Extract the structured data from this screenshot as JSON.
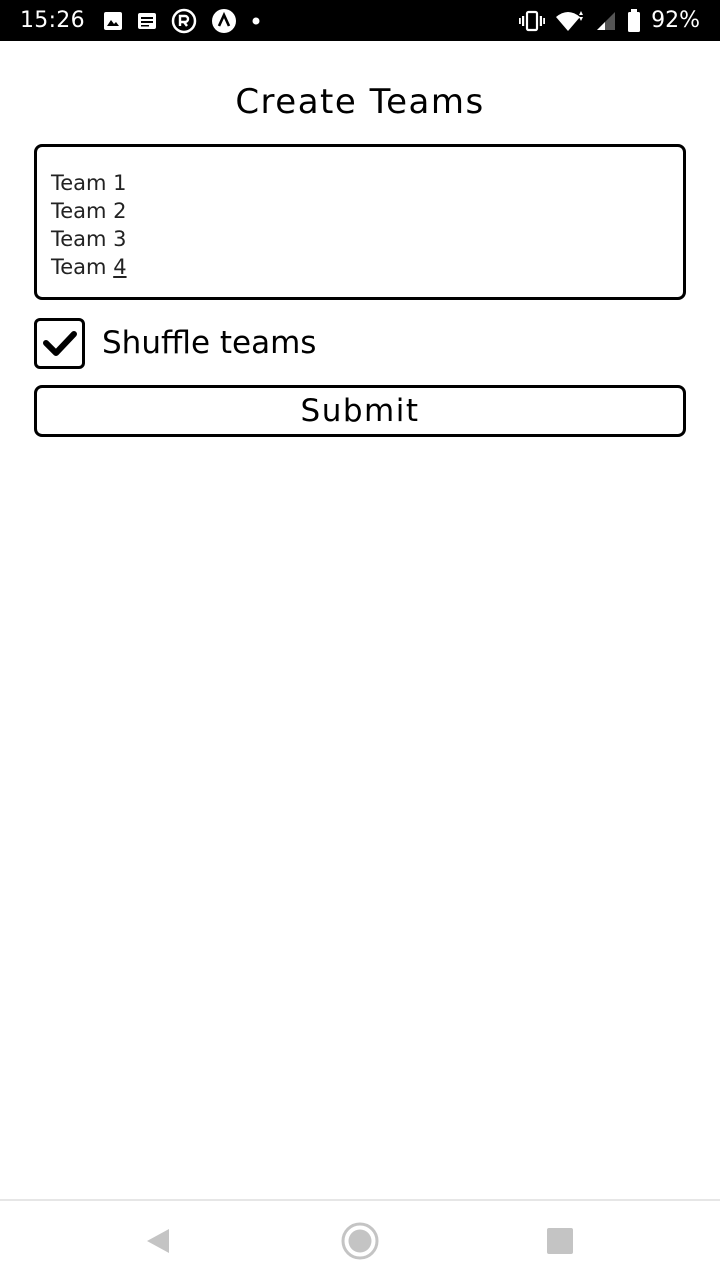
{
  "status_bar": {
    "time": "15:26",
    "left_icons": [
      "image-icon",
      "notes-icon",
      "r-app-icon",
      "caret-app-icon",
      "dot-icon"
    ],
    "right_icons": [
      "vibrate-icon",
      "wifi-icon",
      "signal-icon",
      "battery-icon"
    ],
    "battery_percent": "92%"
  },
  "page": {
    "title": "Create Teams"
  },
  "teams_input": {
    "lines": [
      "Team 1",
      "Team 2",
      "Team 3",
      "Team "
    ],
    "last_line_underlined_part": "4"
  },
  "shuffle": {
    "label": "Shuffle teams",
    "checked": true
  },
  "submit": {
    "label": "Submit"
  },
  "nav_bar": {
    "icons": [
      "back-icon",
      "home-icon",
      "recents-icon"
    ]
  },
  "colors": {
    "status_bar_bg": "#000000",
    "text": "#000000",
    "input_text": "#222222",
    "nav_icon": "#c4c4c4",
    "background": "#ffffff"
  }
}
